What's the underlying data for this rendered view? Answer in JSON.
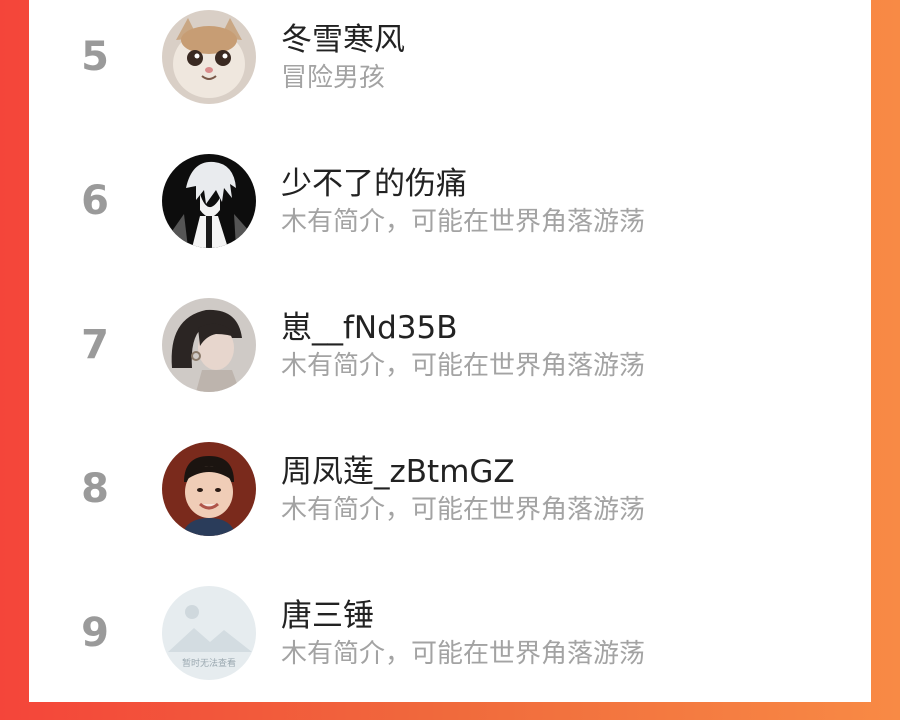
{
  "list": {
    "items": [
      {
        "rank": "5",
        "name": "冬雪寒风",
        "description": "冒险男孩",
        "avatar_icon": "cat-avatar-icon"
      },
      {
        "rank": "6",
        "name": "少不了的伤痛",
        "description": "木有简介，可能在世界角落游荡",
        "avatar_icon": "anime-boy-avatar-icon"
      },
      {
        "rank": "7",
        "name": "崽__fNd35B",
        "description": "木有简介，可能在世界角落游荡",
        "avatar_icon": "girl-avatar-icon"
      },
      {
        "rank": "8",
        "name": "周凤莲_zBtmGZ",
        "description": "木有简介，可能在世界角落游荡",
        "avatar_icon": "child-avatar-icon"
      },
      {
        "rank": "9",
        "name": "唐三锤",
        "description": "木有简介，可能在世界角落游荡",
        "avatar_icon": "image-unavailable-icon",
        "avatar_caption": "暂时无法查看"
      }
    ]
  }
}
